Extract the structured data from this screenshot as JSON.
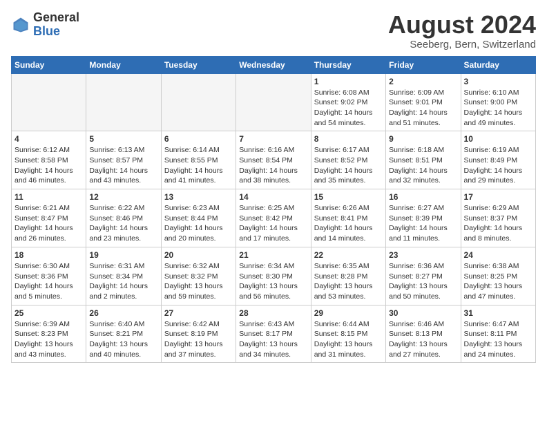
{
  "header": {
    "logo_general": "General",
    "logo_blue": "Blue",
    "title": "August 2024",
    "subtitle": "Seeberg, Bern, Switzerland"
  },
  "weekdays": [
    "Sunday",
    "Monday",
    "Tuesday",
    "Wednesday",
    "Thursday",
    "Friday",
    "Saturday"
  ],
  "weeks": [
    [
      {
        "day": "",
        "info": ""
      },
      {
        "day": "",
        "info": ""
      },
      {
        "day": "",
        "info": ""
      },
      {
        "day": "",
        "info": ""
      },
      {
        "day": "1",
        "info": "Sunrise: 6:08 AM\nSunset: 9:02 PM\nDaylight: 14 hours\nand 54 minutes."
      },
      {
        "day": "2",
        "info": "Sunrise: 6:09 AM\nSunset: 9:01 PM\nDaylight: 14 hours\nand 51 minutes."
      },
      {
        "day": "3",
        "info": "Sunrise: 6:10 AM\nSunset: 9:00 PM\nDaylight: 14 hours\nand 49 minutes."
      }
    ],
    [
      {
        "day": "4",
        "info": "Sunrise: 6:12 AM\nSunset: 8:58 PM\nDaylight: 14 hours\nand 46 minutes."
      },
      {
        "day": "5",
        "info": "Sunrise: 6:13 AM\nSunset: 8:57 PM\nDaylight: 14 hours\nand 43 minutes."
      },
      {
        "day": "6",
        "info": "Sunrise: 6:14 AM\nSunset: 8:55 PM\nDaylight: 14 hours\nand 41 minutes."
      },
      {
        "day": "7",
        "info": "Sunrise: 6:16 AM\nSunset: 8:54 PM\nDaylight: 14 hours\nand 38 minutes."
      },
      {
        "day": "8",
        "info": "Sunrise: 6:17 AM\nSunset: 8:52 PM\nDaylight: 14 hours\nand 35 minutes."
      },
      {
        "day": "9",
        "info": "Sunrise: 6:18 AM\nSunset: 8:51 PM\nDaylight: 14 hours\nand 32 minutes."
      },
      {
        "day": "10",
        "info": "Sunrise: 6:19 AM\nSunset: 8:49 PM\nDaylight: 14 hours\nand 29 minutes."
      }
    ],
    [
      {
        "day": "11",
        "info": "Sunrise: 6:21 AM\nSunset: 8:47 PM\nDaylight: 14 hours\nand 26 minutes."
      },
      {
        "day": "12",
        "info": "Sunrise: 6:22 AM\nSunset: 8:46 PM\nDaylight: 14 hours\nand 23 minutes."
      },
      {
        "day": "13",
        "info": "Sunrise: 6:23 AM\nSunset: 8:44 PM\nDaylight: 14 hours\nand 20 minutes."
      },
      {
        "day": "14",
        "info": "Sunrise: 6:25 AM\nSunset: 8:42 PM\nDaylight: 14 hours\nand 17 minutes."
      },
      {
        "day": "15",
        "info": "Sunrise: 6:26 AM\nSunset: 8:41 PM\nDaylight: 14 hours\nand 14 minutes."
      },
      {
        "day": "16",
        "info": "Sunrise: 6:27 AM\nSunset: 8:39 PM\nDaylight: 14 hours\nand 11 minutes."
      },
      {
        "day": "17",
        "info": "Sunrise: 6:29 AM\nSunset: 8:37 PM\nDaylight: 14 hours\nand 8 minutes."
      }
    ],
    [
      {
        "day": "18",
        "info": "Sunrise: 6:30 AM\nSunset: 8:36 PM\nDaylight: 14 hours\nand 5 minutes."
      },
      {
        "day": "19",
        "info": "Sunrise: 6:31 AM\nSunset: 8:34 PM\nDaylight: 14 hours\nand 2 minutes."
      },
      {
        "day": "20",
        "info": "Sunrise: 6:32 AM\nSunset: 8:32 PM\nDaylight: 13 hours\nand 59 minutes."
      },
      {
        "day": "21",
        "info": "Sunrise: 6:34 AM\nSunset: 8:30 PM\nDaylight: 13 hours\nand 56 minutes."
      },
      {
        "day": "22",
        "info": "Sunrise: 6:35 AM\nSunset: 8:28 PM\nDaylight: 13 hours\nand 53 minutes."
      },
      {
        "day": "23",
        "info": "Sunrise: 6:36 AM\nSunset: 8:27 PM\nDaylight: 13 hours\nand 50 minutes."
      },
      {
        "day": "24",
        "info": "Sunrise: 6:38 AM\nSunset: 8:25 PM\nDaylight: 13 hours\nand 47 minutes."
      }
    ],
    [
      {
        "day": "25",
        "info": "Sunrise: 6:39 AM\nSunset: 8:23 PM\nDaylight: 13 hours\nand 43 minutes."
      },
      {
        "day": "26",
        "info": "Sunrise: 6:40 AM\nSunset: 8:21 PM\nDaylight: 13 hours\nand 40 minutes."
      },
      {
        "day": "27",
        "info": "Sunrise: 6:42 AM\nSunset: 8:19 PM\nDaylight: 13 hours\nand 37 minutes."
      },
      {
        "day": "28",
        "info": "Sunrise: 6:43 AM\nSunset: 8:17 PM\nDaylight: 13 hours\nand 34 minutes."
      },
      {
        "day": "29",
        "info": "Sunrise: 6:44 AM\nSunset: 8:15 PM\nDaylight: 13 hours\nand 31 minutes."
      },
      {
        "day": "30",
        "info": "Sunrise: 6:46 AM\nSunset: 8:13 PM\nDaylight: 13 hours\nand 27 minutes."
      },
      {
        "day": "31",
        "info": "Sunrise: 6:47 AM\nSunset: 8:11 PM\nDaylight: 13 hours\nand 24 minutes."
      }
    ]
  ]
}
